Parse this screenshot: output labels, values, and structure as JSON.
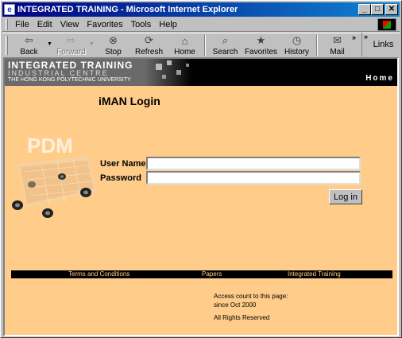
{
  "window": {
    "title": "INTEGRATED TRAINING - Microsoft Internet Explorer",
    "controls": {
      "minimize": "_",
      "maximize": "□",
      "close": "✕"
    }
  },
  "menubar": {
    "items": [
      {
        "label": "File",
        "icon": ""
      },
      {
        "label": "Edit",
        "icon": ""
      },
      {
        "label": "View",
        "icon": ""
      },
      {
        "label": "Favorites",
        "icon": ""
      },
      {
        "label": "Tools",
        "icon": ""
      },
      {
        "label": "Help",
        "icon": ""
      }
    ]
  },
  "toolbar": {
    "back": {
      "label": "Back",
      "icon": "back-arrow-icon"
    },
    "forward": {
      "label": "Forward",
      "icon": "forward-arrow-icon",
      "disabled": true
    },
    "stop": {
      "label": "Stop",
      "icon": "stop-icon"
    },
    "refresh": {
      "label": "Refresh",
      "icon": "refresh-icon"
    },
    "home": {
      "label": "Home",
      "icon": "home-icon"
    },
    "search": {
      "label": "Search",
      "icon": "search-icon"
    },
    "favorites": {
      "label": "Favorites",
      "icon": "favorites-icon"
    },
    "history": {
      "label": "History",
      "icon": "history-icon"
    },
    "mail": {
      "label": "Mail",
      "icon": "mail-icon"
    },
    "links": "Links",
    "chevron": "»"
  },
  "banner": {
    "line1": "INTEGRATED TRAINING",
    "line2": "INDUSTRIAL CENTRE",
    "line3": "THE HONG KONG POLYTECHNIC UNIVERSITY",
    "home_link": "Home"
  },
  "login": {
    "title": "iMAN Login",
    "username_label": "User Name",
    "username_value": "",
    "password_label": "Password",
    "password_value": "",
    "submit_label": "Log in"
  },
  "pdm_graphic": {
    "text": "PDM"
  },
  "footer": {
    "links": [
      "Terms and Conditions",
      "Papers",
      "Integrated Training"
    ],
    "counter_line1": "Access count to this page:",
    "counter_line2": "since Oct 2000",
    "rights": "All Rights Reserved"
  },
  "colors": {
    "page_background": "#ffcc8a",
    "titlebar_start": "#000080",
    "titlebar_end": "#1084d0",
    "chrome": "#c0c0c0"
  }
}
